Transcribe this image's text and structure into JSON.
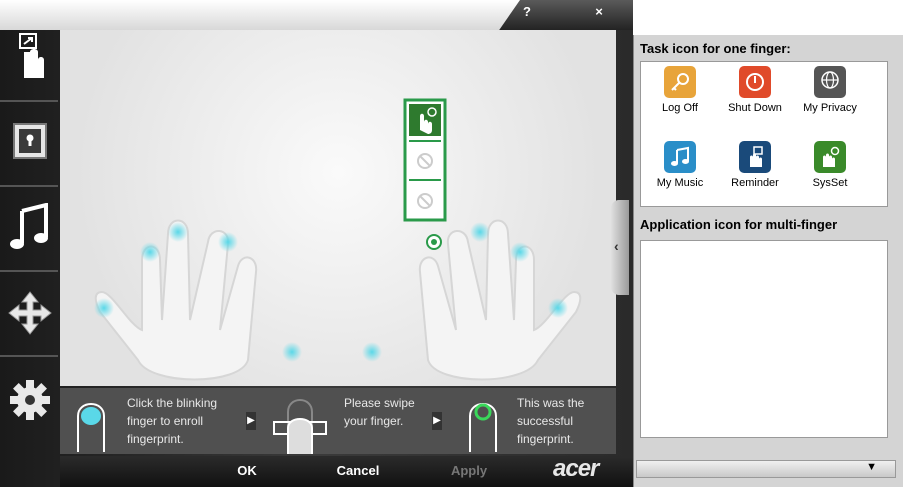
{
  "window": {
    "help_label": "?",
    "close_label": "×"
  },
  "sidebar": {
    "items": [
      {
        "name": "reminder-finger-icon"
      },
      {
        "name": "lock-icon"
      },
      {
        "name": "music-note-icon"
      },
      {
        "name": "move-arrows-icon"
      },
      {
        "name": "gear-icon"
      }
    ]
  },
  "tips": [
    {
      "text_1": "Click the blinking",
      "text_2": "finger to enroll",
      "text_3": "fingerprint."
    },
    {
      "text_1": "Please swipe",
      "text_2": "your finger."
    },
    {
      "text_1": "This was the",
      "text_2": "successful",
      "text_3": "fingerprint."
    }
  ],
  "buttons": {
    "ok": "OK",
    "cancel": "Cancel",
    "apply": "Apply"
  },
  "brand": {
    "logo": "acer"
  },
  "right_panel": {
    "task_title": "Task icon for one finger:",
    "task_icons": [
      {
        "label": "Log Off",
        "color": "#e8a43a"
      },
      {
        "label": "Shut Down",
        "color": "#e04a2a"
      },
      {
        "label": "My Privacy",
        "color": "#555555"
      },
      {
        "label": "My Music",
        "color": "#2a8ec8"
      },
      {
        "label": "Reminder",
        "color": "#1a4a7a"
      },
      {
        "label": "SysSet",
        "color": "#3a8a2a"
      }
    ],
    "app_title": "Application icon for multi-finger"
  },
  "colors": {
    "accent_green": "#2a9a4a",
    "finger_glow": "#5ad8e8"
  }
}
